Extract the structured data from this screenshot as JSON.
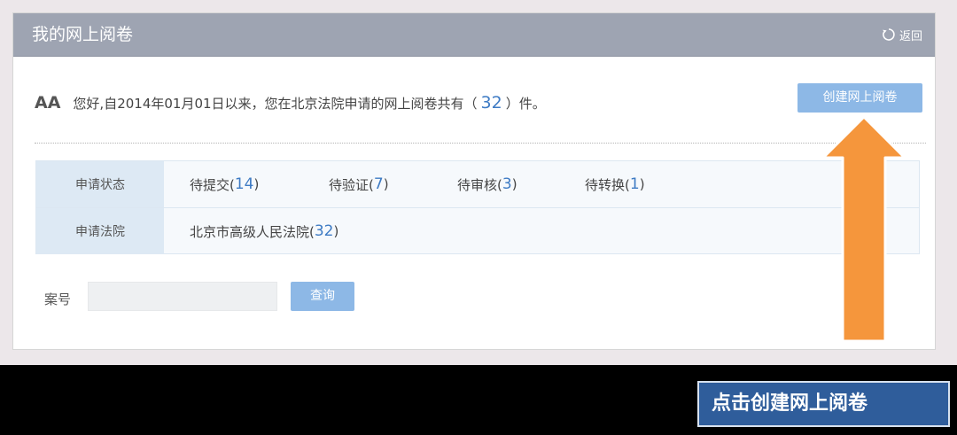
{
  "header": {
    "title": "我的网上阅卷",
    "back_label": "返回"
  },
  "greeting": {
    "user": "AA",
    "text_before": "您好,自2014年01月01日以来，您在北京法院申请的网上阅卷共有（",
    "count": "32",
    "text_after": "）件。"
  },
  "create_button": "创建网上阅卷",
  "filters": {
    "status": {
      "label": "申请状态",
      "options": [
        {
          "label": "待提交(",
          "count": "14",
          "close": ")"
        },
        {
          "label": "待验证(",
          "count": "7",
          "close": ")"
        },
        {
          "label": "待审核(",
          "count": "3",
          "close": ")"
        },
        {
          "label": "待转换(",
          "count": "1",
          "close": ")"
        }
      ]
    },
    "court": {
      "label": "申请法院",
      "options": [
        {
          "label": "北京市高级人民法院(",
          "count": "32",
          "close": ")"
        }
      ]
    }
  },
  "search": {
    "case_label": "案号",
    "case_value": "",
    "query_button": "查询"
  },
  "watermark": "点击创建网上阅卷",
  "colors": {
    "header": "#9ea4b2",
    "accent_button": "#8db8e6",
    "count": "#3e7bc4",
    "arrow": "#f5963c"
  }
}
